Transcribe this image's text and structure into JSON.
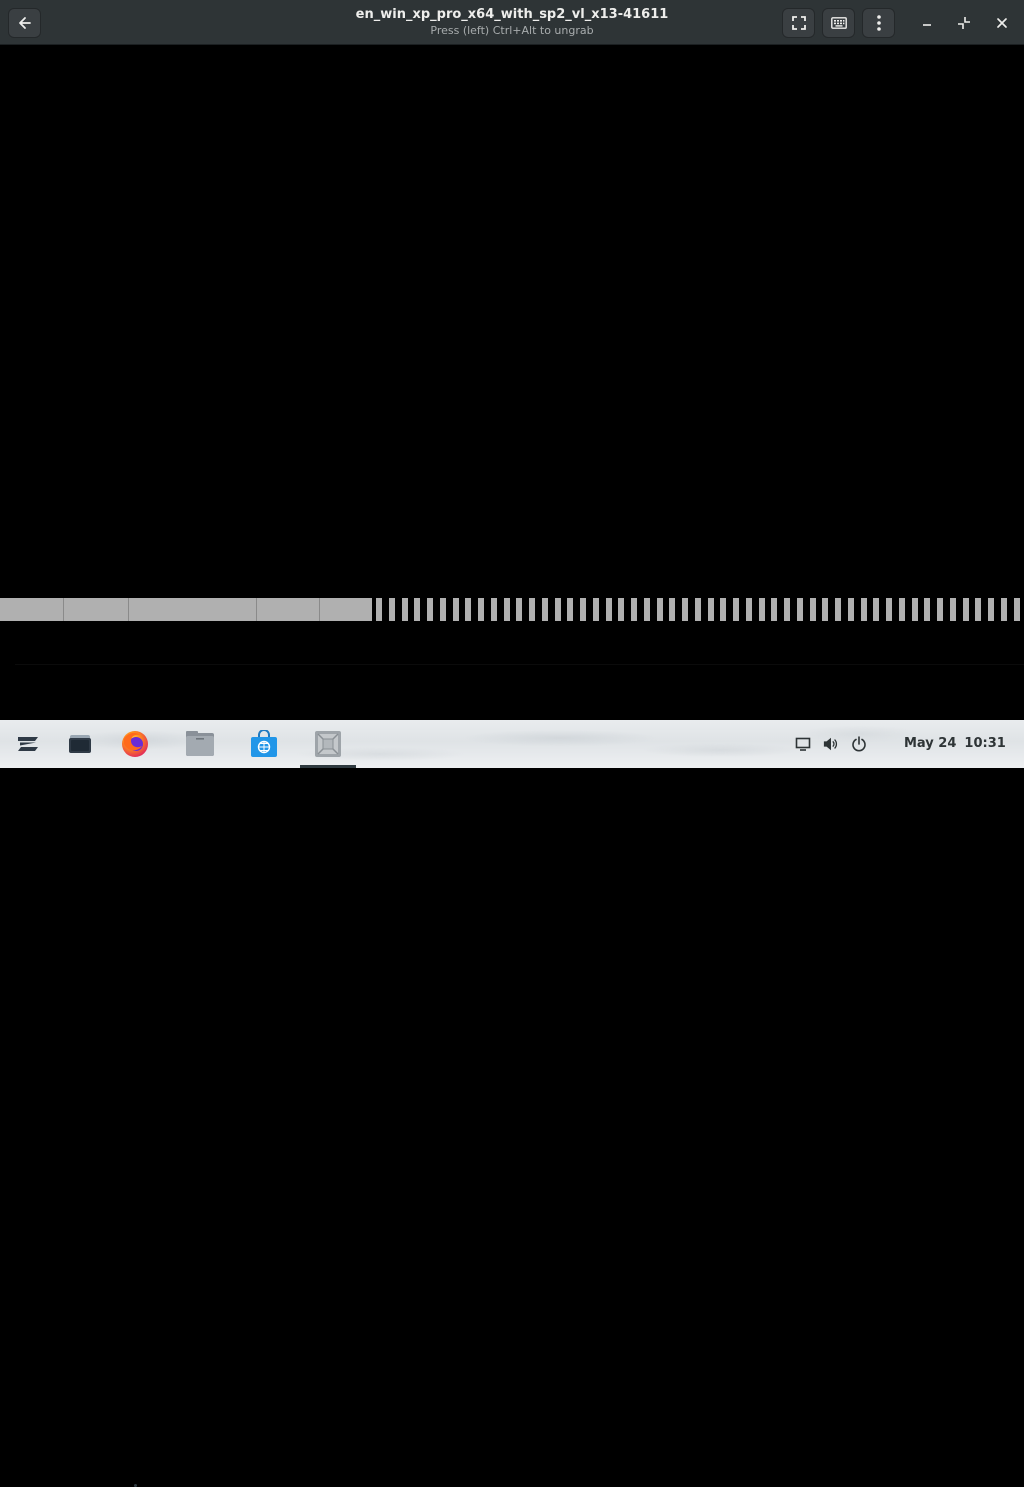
{
  "window": {
    "title": "en_win_xp_pro_x64_with_sp2_vl_x13-41611",
    "subtitle": "Press (left) Ctrl+Alt to ungrab"
  },
  "header_icons": {
    "back": "arrow-left-icon",
    "fullscreen": "fullscreen-icon",
    "keyboard": "keyboard-icon",
    "menu": "kebab-menu-icon",
    "minimize": "minimize-icon",
    "restore": "unmaximize-icon",
    "close": "close-icon"
  },
  "vm_screen": {
    "background": "#000000",
    "progress_fill_color": "#b0b0b0",
    "progress_solid_fraction": 0.363,
    "progress_filled_blocks": 5
  },
  "taskbar": {
    "apps": [
      {
        "name": "zorin-menu-icon",
        "running": false
      },
      {
        "name": "workspaces-icon",
        "running": false
      },
      {
        "name": "firefox-icon",
        "running": true
      },
      {
        "name": "files-icon",
        "running": false
      },
      {
        "name": "software-store-icon",
        "running": false
      },
      {
        "name": "boxes-icon",
        "running": true,
        "active": true
      }
    ],
    "tray": [
      "screen-icon",
      "volume-icon",
      "power-icon"
    ],
    "date": "May 24",
    "time": "10:31"
  }
}
